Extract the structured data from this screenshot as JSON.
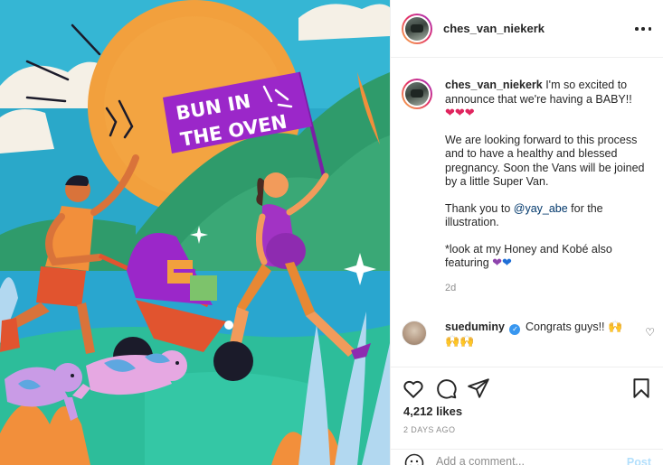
{
  "post": {
    "image_alt": "Illustrated pregnancy announcement: couple walking with a stroller and dogs under a big sun",
    "banner_text": [
      "BUN IN",
      "THE OVEN"
    ]
  },
  "header": {
    "username": "ches_van_niekerk",
    "more_icon": "more-horizontal-icon"
  },
  "caption": {
    "username": "ches_van_niekerk",
    "text_line1": "I'm so excited to announce that we're having a BABY!!",
    "hearts": "❤❤❤",
    "text_para2": "We are looking forward to this process and to have a healthy and blessed pregnancy. Soon the Vans will be joined by a little Super Van.",
    "text_para3_before": "Thank you to ",
    "mention": "@yay_abe",
    "text_para3_after": " for the illustration.",
    "text_para4": "*look at my Honey and Kobé also featuring",
    "hearts2_purple": "❤",
    "hearts2_blue": "❤",
    "time": "2d"
  },
  "comments": [
    {
      "username": "sueduminy",
      "verified": true,
      "text": "Congrats guys!!",
      "emoji": "🙌",
      "emoji_line2": "🙌🙌"
    }
  ],
  "actions": {
    "like_icon": "heart-outline-icon",
    "comment_icon": "comment-bubble-icon",
    "share_icon": "paper-plane-icon",
    "save_icon": "bookmark-icon",
    "likes": "4,212 likes",
    "date": "2 DAYS AGO"
  },
  "add_comment": {
    "placeholder": "Add a comment...",
    "post_label": "Post",
    "emoji_icon": "smiley-icon"
  },
  "colors": {
    "sky": "#2aa8c9",
    "sun": "#f2a03d",
    "banner": "#9b27c9",
    "hill": "#2f9b6b",
    "link": "#00376b",
    "post_disabled": "#b2dffc",
    "heart_red": "#e0245e"
  }
}
